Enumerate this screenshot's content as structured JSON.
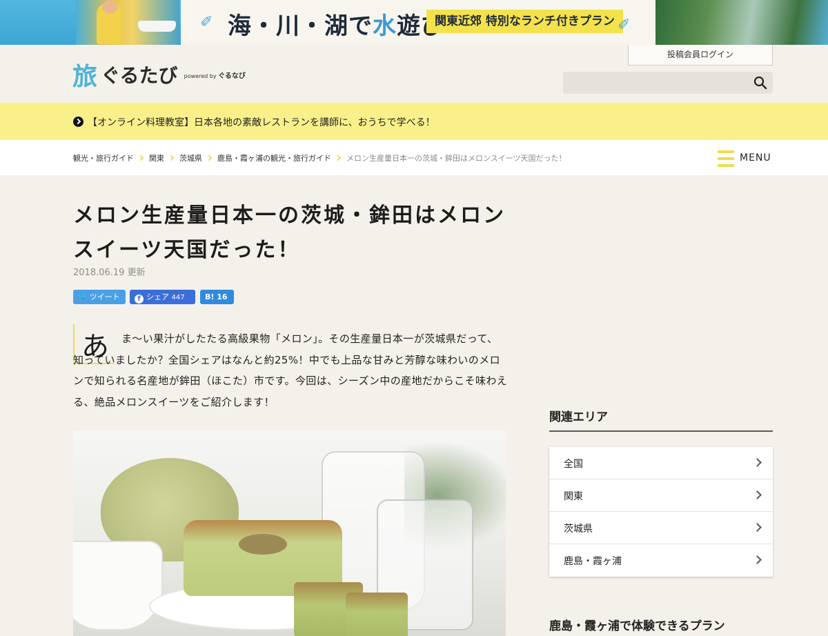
{
  "banner": {
    "title_pre": "海・川・湖で",
    "title_blue": "水",
    "title_post": "遊び",
    "badge": "関東近郊 特別なランチ付きプラン"
  },
  "header": {
    "logo_kanji": "旅",
    "logo_kana": "ぐるたび",
    "logo_powered": "powered by",
    "logo_powered_brand": "ぐるなび",
    "login_label": "投稿会員ログイン",
    "search_placeholder": ""
  },
  "notice": {
    "text": "【オンライン料理教室】日本各地の素敵レストランを講師に、おうちで学べる！"
  },
  "breadcrumb": {
    "items": [
      "観光・旅行ガイド",
      "関東",
      "茨城県",
      "鹿島・霞ヶ浦の観光・旅行ガイド"
    ],
    "current": "メロン生産量日本一の茨城・鉾田はメロンスイーツ天国だった！"
  },
  "menu": {
    "label": "MENU"
  },
  "article": {
    "title": "メロン生産量日本一の茨城・鉾田はメロンスイーツ天国だった！",
    "date": "2018.06.19 更新",
    "share": {
      "tweet_label": "ツイート",
      "facebook_label": "シェア",
      "facebook_count": "447",
      "hatena_label": "B!",
      "hatena_count": "16"
    },
    "dropcap": "あ",
    "intro": "ま〜い果汁がしたたる高級果物「メロン」。その生産量日本一が茨城県だって、知っていましたか？全国シェアはなんと約25%！中でも上品な甘みと芳醇な味わいのメロンで知られる名産地が鉾田（ほこた）市です。今回は、シーズン中の産地だからこそ味わえる、絶品メロンスイーツをご紹介します！"
  },
  "sidebar": {
    "related_heading": "関連エリア",
    "areas": [
      "全国",
      "関東",
      "茨城県",
      "鹿島・霞ヶ浦"
    ],
    "plans_heading": "鹿島・霞ヶ浦で体験できるプラン"
  }
}
